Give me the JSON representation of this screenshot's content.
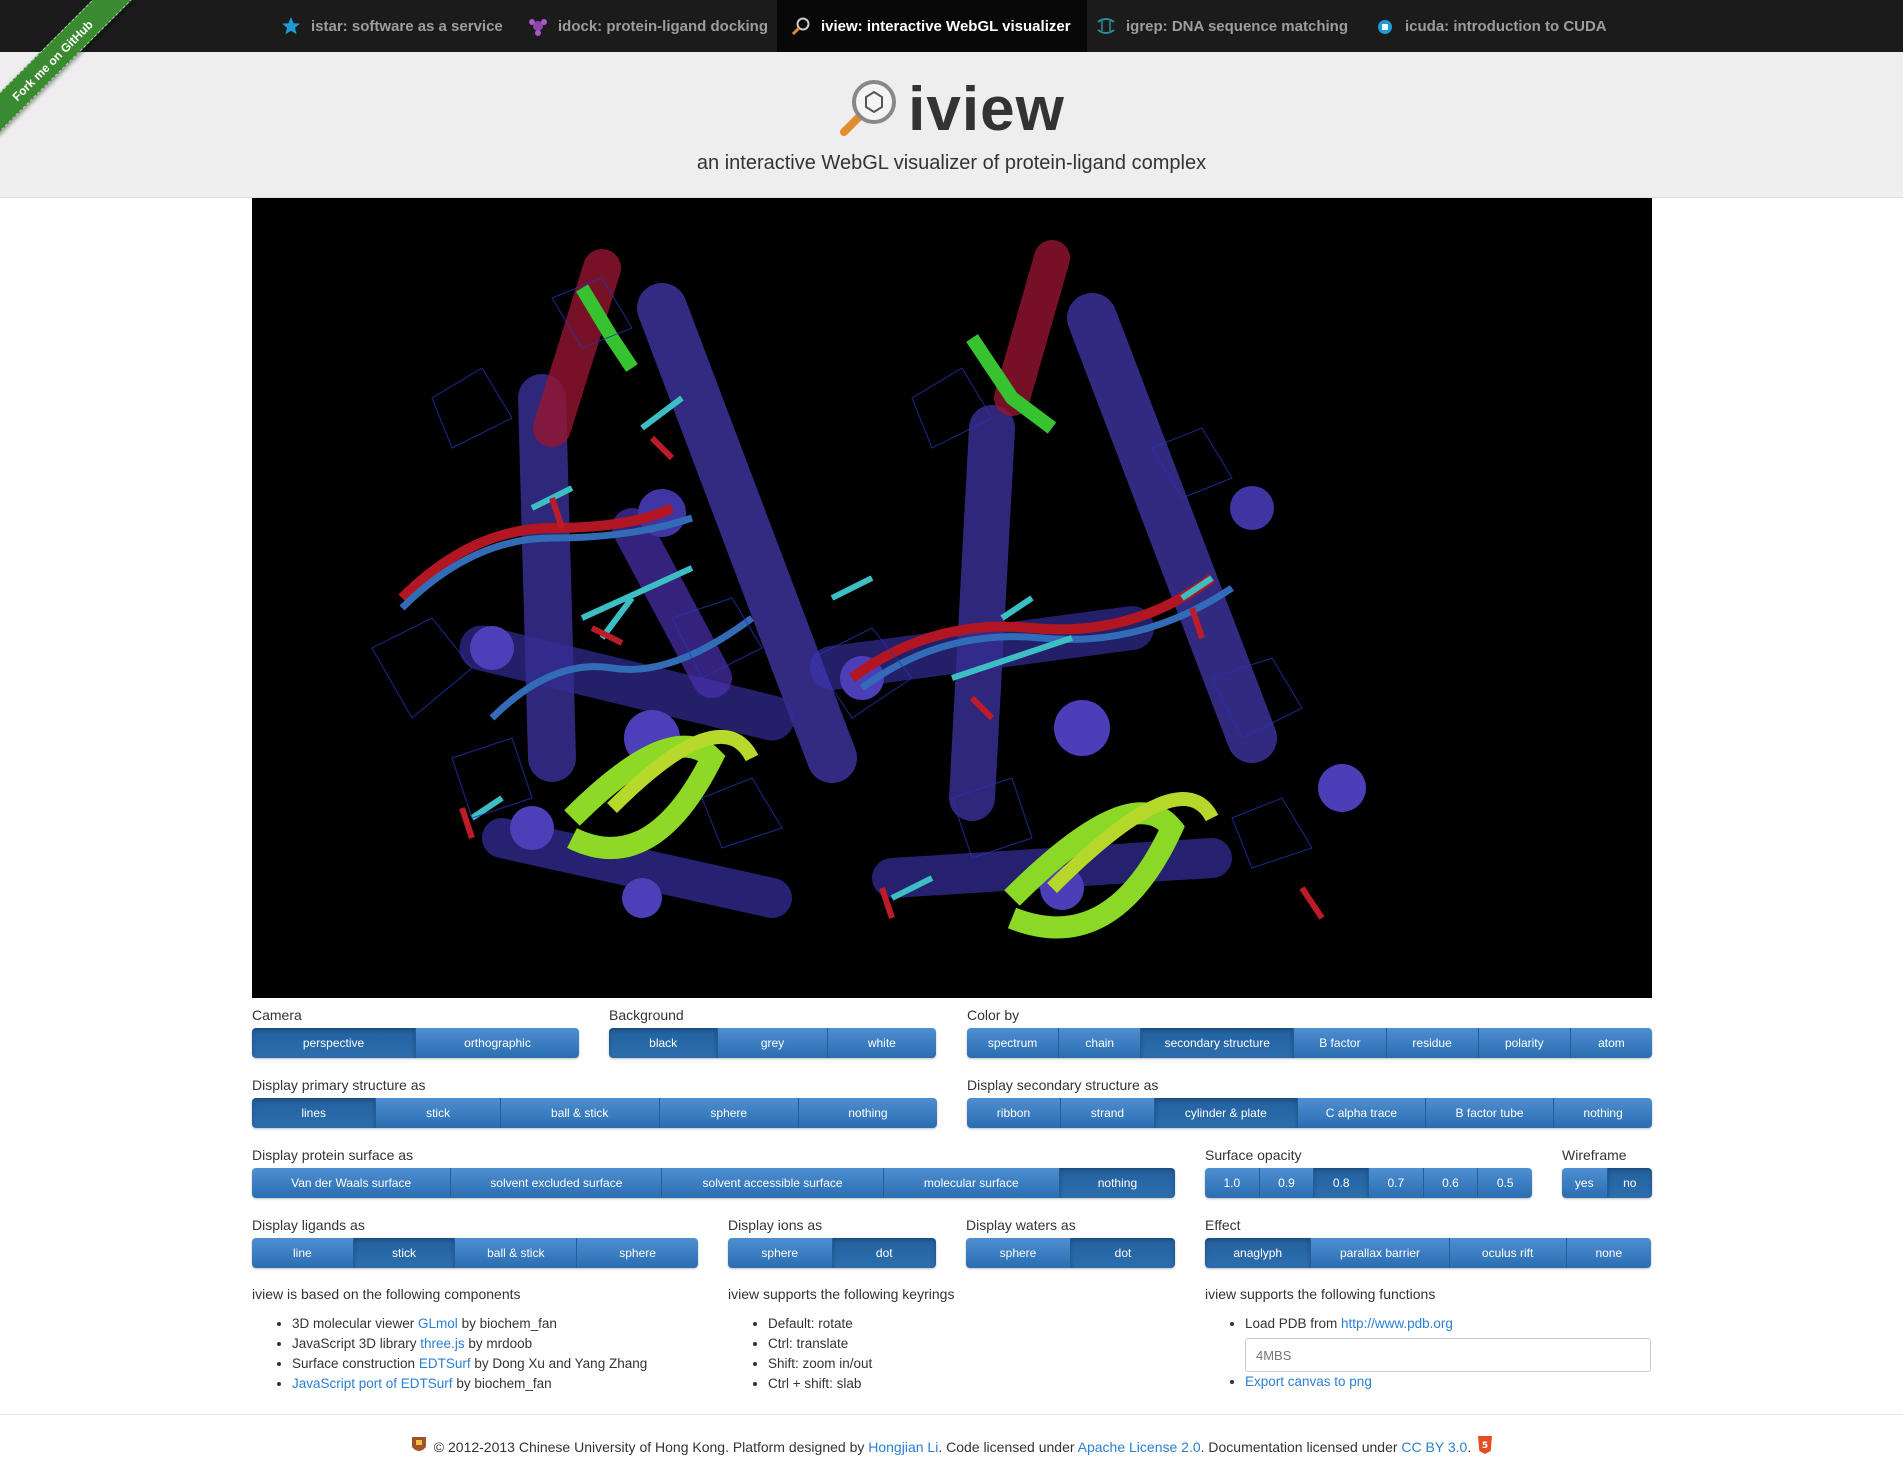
{
  "nav": [
    {
      "label": "istar: software as a service",
      "icon": "star-icon"
    },
    {
      "label": "idock: protein-ligand docking",
      "icon": "molecule-icon"
    },
    {
      "label": "iview: interactive WebGL visualizer",
      "icon": "magnifier-icon"
    },
    {
      "label": "igrep: DNA sequence matching",
      "icon": "dna-icon"
    },
    {
      "label": "icuda: introduction to CUDA",
      "icon": "chip-icon"
    }
  ],
  "ribbon": "Fork me on GitHub",
  "header": {
    "title": "iview",
    "subtitle": "an interactive WebGL visualizer of protein-ligand complex"
  },
  "controls": {
    "camera": {
      "label": "Camera",
      "options": [
        "perspective",
        "orthographic"
      ],
      "active": "perspective"
    },
    "background": {
      "label": "Background",
      "options": [
        "black",
        "grey",
        "white"
      ],
      "active": "black"
    },
    "colorby": {
      "label": "Color by",
      "options": [
        "spectrum",
        "chain",
        "secondary structure",
        "B factor",
        "residue",
        "polarity",
        "atom"
      ],
      "active": "secondary structure"
    },
    "primary": {
      "label": "Display primary structure as",
      "options": [
        "lines",
        "stick",
        "ball & stick",
        "sphere",
        "nothing"
      ],
      "active": "lines"
    },
    "secondary": {
      "label": "Display secondary structure as",
      "options": [
        "ribbon",
        "strand",
        "cylinder & plate",
        "C alpha trace",
        "B factor tube",
        "nothing"
      ],
      "active": "cylinder & plate"
    },
    "surface": {
      "label": "Display protein surface as",
      "options": [
        "Van der Waals surface",
        "solvent excluded surface",
        "solvent accessible surface",
        "molecular surface",
        "nothing"
      ],
      "active": "nothing"
    },
    "opacity": {
      "label": "Surface opacity",
      "options": [
        "1.0",
        "0.9",
        "0.8",
        "0.7",
        "0.6",
        "0.5"
      ],
      "active": "0.8"
    },
    "wireframe": {
      "label": "Wireframe",
      "options": [
        "yes",
        "no"
      ],
      "active": "no"
    },
    "ligands": {
      "label": "Display ligands as",
      "options": [
        "line",
        "stick",
        "ball & stick",
        "sphere"
      ],
      "active": "stick"
    },
    "ions": {
      "label": "Display ions as",
      "options": [
        "sphere",
        "dot"
      ],
      "active": "dot"
    },
    "waters": {
      "label": "Display waters as",
      "options": [
        "sphere",
        "dot"
      ],
      "active": "dot"
    },
    "effect": {
      "label": "Effect",
      "options": [
        "anaglyph",
        "parallax barrier",
        "oculus rift",
        "none"
      ],
      "active": "anaglyph"
    }
  },
  "components": {
    "title": "iview is based on the following components",
    "items": [
      {
        "pre": "3D molecular viewer ",
        "link": "GLmol",
        "post": " by biochem_fan"
      },
      {
        "pre": "JavaScript 3D library ",
        "link": "three.js",
        "post": " by mrdoob"
      },
      {
        "pre": "Surface construction ",
        "link": "EDTSurf",
        "post": " by Dong Xu and Yang Zhang"
      },
      {
        "pre": "",
        "link": "JavaScript port of EDTSurf",
        "post": " by biochem_fan"
      }
    ]
  },
  "keyrings": {
    "title": "iview supports the following keyrings",
    "items": [
      "Default: rotate",
      "Ctrl: translate",
      "Shift: zoom in/out",
      "Ctrl + shift: slab"
    ]
  },
  "functions": {
    "title": "iview supports the following functions",
    "load_pre": "Load PDB from ",
    "load_link": "http://www.pdb.org",
    "pdb_placeholder": "4MBS",
    "export": "Export canvas to png"
  },
  "footer": {
    "copy": "© 2012-2013 Chinese University of Hong Kong. Platform designed by ",
    "author": "Hongjian Li",
    "mid": ". Code licensed under ",
    "license": "Apache License 2.0",
    "mid2": ". Documentation licensed under ",
    "doc_license": "CC BY 3.0",
    "end": "."
  }
}
